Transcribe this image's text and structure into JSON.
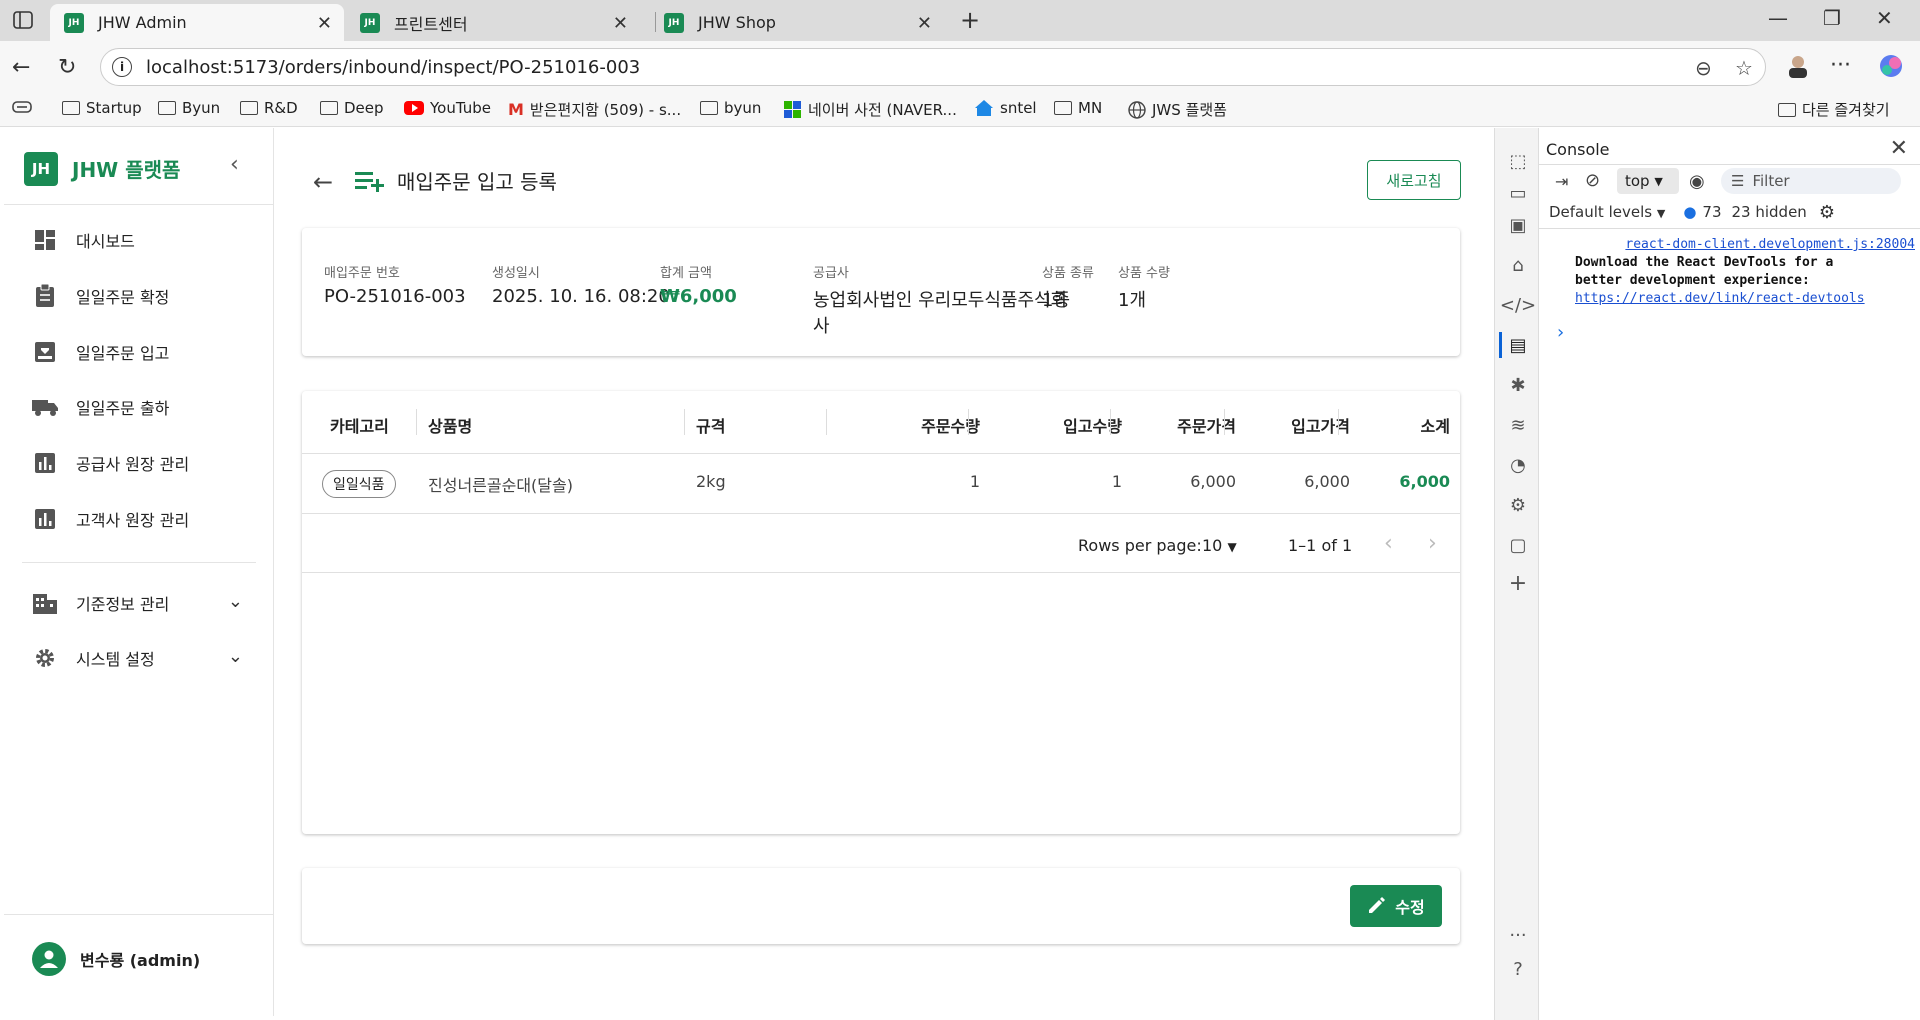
{
  "browser": {
    "tabs": [
      {
        "title": "JHW Admin",
        "favicon": "JH",
        "active": true
      },
      {
        "title": "프린트센터",
        "favicon": "JH",
        "active": false
      },
      {
        "title": "JHW Shop",
        "favicon": "JH",
        "active": false
      }
    ],
    "url": "localhost:5173/orders/inbound/inspect/PO-251016-003",
    "bookmarks": [
      {
        "label": "Startup",
        "icon": "folder-icon"
      },
      {
        "label": "Byun",
        "icon": "folder-icon"
      },
      {
        "label": "R&D",
        "icon": "folder-icon"
      },
      {
        "label": "Deep",
        "icon": "folder-icon"
      },
      {
        "label": "YouTube",
        "icon": "youtube-icon"
      },
      {
        "label": "받은편지함 (509) - s...",
        "icon": "gmail-icon"
      },
      {
        "label": "byun",
        "icon": "folder-icon"
      },
      {
        "label": "네이버 사전 (NAVER...",
        "icon": "naver-dict-icon"
      },
      {
        "label": "sntel",
        "icon": "house-icon"
      },
      {
        "label": "MN",
        "icon": "folder-icon"
      },
      {
        "label": "JWS 플랫폼",
        "icon": "globe-icon"
      }
    ],
    "other_bookmarks": "다른 즐겨찾기"
  },
  "sidebar": {
    "logo": "JH",
    "brand": "JHW 플랫폼",
    "items": [
      {
        "label": "대시보드",
        "icon": "dashboard-icon"
      },
      {
        "label": "일일주문 확정",
        "icon": "clipboard-icon"
      },
      {
        "label": "일일주문 입고",
        "icon": "inbox-download-icon"
      },
      {
        "label": "일일주문 출하",
        "icon": "truck-icon"
      },
      {
        "label": "공급사 원장 관리",
        "icon": "bar-chart-icon"
      },
      {
        "label": "고객사 원장 관리",
        "icon": "bar-chart-icon"
      }
    ],
    "groups": [
      {
        "label": "기준정보 관리",
        "icon": "building-icon"
      },
      {
        "label": "시스템 설정",
        "icon": "gear-icon"
      }
    ],
    "user": "변수룡 (admin)"
  },
  "page": {
    "title": "매입주문 입고 등록",
    "refresh_label": "새로고침",
    "summary": {
      "po_number_label": "매입주문 번호",
      "po_number": "PO-251016-003",
      "created_label": "생성일시",
      "created": "2025. 10. 16. 08:20",
      "total_label": "합계 금액",
      "total": "₩6,000",
      "supplier_label": "공급사",
      "supplier_line1": "농업회사법인 우리모두식품주식회",
      "supplier_line2": "사",
      "kinds_label": "상품 종류",
      "kinds": "1종",
      "qty_label": "상품 수량",
      "qty": "1개"
    },
    "table": {
      "headers": [
        "카테고리",
        "상품명",
        "규격",
        "주문수량",
        "입고수량",
        "주문가격",
        "입고가격",
        "소계"
      ],
      "rows": [
        {
          "category": "일일식품",
          "name": "진성너른골순대(달솔)",
          "spec": "2kg",
          "order_qty": "1",
          "inbound_qty": "1",
          "order_price": "6,000",
          "inbound_price": "6,000",
          "subtotal": "6,000"
        }
      ],
      "rows_per_page_label": "Rows per page:",
      "rows_per_page": "10",
      "range": "1–1 of 1"
    },
    "edit_label": "수정"
  },
  "devtools": {
    "panel_title": "Console",
    "context": "top",
    "filter_placeholder": "Filter",
    "levels": "Default levels",
    "issues_count": "73",
    "hidden": "23 hidden",
    "source_link": "react-dom-client.development.js:28004",
    "message_line1": "Download the React DevTools for a",
    "message_line2": "better development experience:",
    "message_link": "https://react.dev/link/react-devtools"
  },
  "colors": {
    "accent": "#1a8a54",
    "link": "#1a4fd1"
  }
}
